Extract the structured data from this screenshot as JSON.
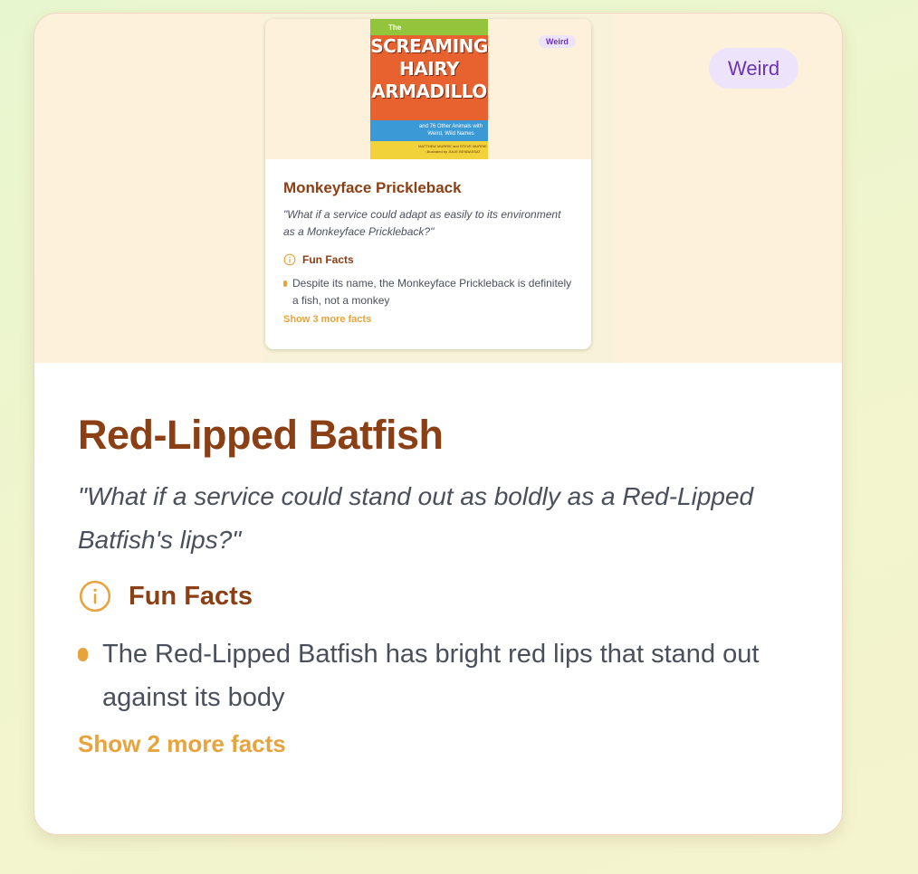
{
  "badge": "Weird",
  "title": "Red-Lipped Batfish",
  "quote": "\"What if a service could stand out as boldly as a Red-Lipped Batfish's lips?\"",
  "fun_facts": {
    "heading": "Fun Facts",
    "items": [
      "The Red-Lipped Batfish has bright red lips that stand out against its body"
    ],
    "more_label": "Show 2 more facts"
  },
  "embedded_card": {
    "badge": "Weird",
    "title": "Monkeyface Prickleback",
    "quote": "\"What if a service could adapt as easily to its environment as a Monkeyface Prickleback?\"",
    "fun_facts": {
      "heading": "Fun Facts",
      "items": [
        "Despite its name, the Monkeyface Prickleback is definitely a fish, not a monkey"
      ],
      "more_label": "Show 3 more facts"
    },
    "book_cover": {
      "the": "The",
      "title_line1": "SCREAMING",
      "title_line2": "HAIRY",
      "title_line3": "ARMADILLO",
      "subtitle": "and 76 Other Animals with Weird, Wild Names",
      "authors": "MATTHEW MURRIE and STEVE MURRIE · illustrated by JULIE BENBASSAT"
    }
  },
  "colors": {
    "title": "#8b3f14",
    "accent": "#e8a33c",
    "badge_bg": "#ede3fb",
    "badge_text": "#6b34b2",
    "text": "#4a4f5c"
  },
  "icons": [
    "info-icon"
  ]
}
